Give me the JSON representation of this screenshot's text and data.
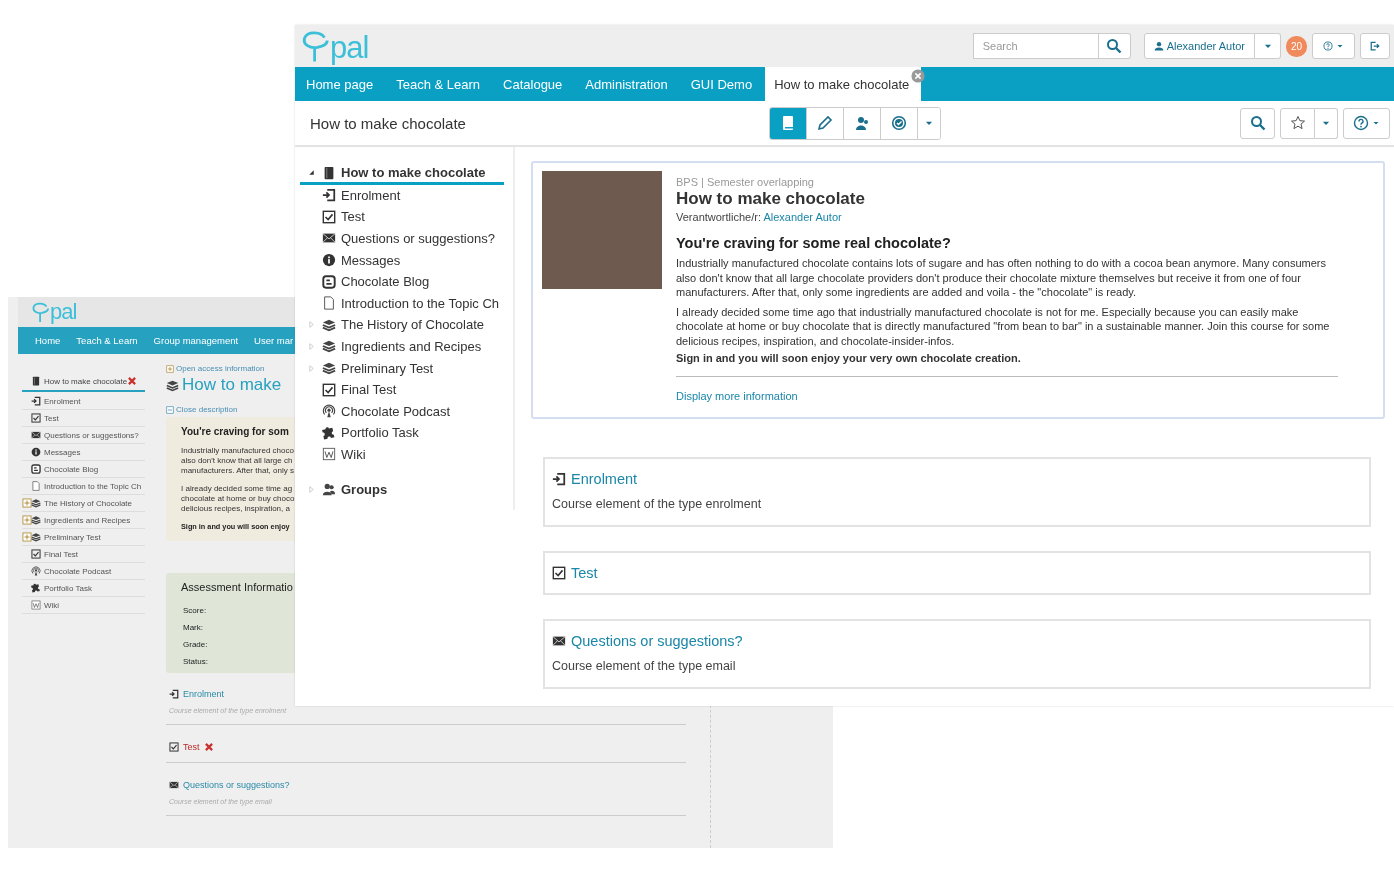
{
  "back_window": {
    "logo": "pal",
    "nav": [
      {
        "label": "Home"
      },
      {
        "label": "Teach & Learn"
      },
      {
        "label": "Group management"
      },
      {
        "label": "User mar"
      }
    ],
    "tree": [
      {
        "label": "How to make chocolate",
        "kind": "course",
        "selected": true,
        "failed": true,
        "children": [
          {
            "label": "Enrolment",
            "kind": "enrolment",
            "selected": false,
            "failed": false
          },
          {
            "label": "Test",
            "kind": "test",
            "selected": false,
            "failed": false
          },
          {
            "label": "Questions or suggestions?",
            "kind": "mail",
            "selected": false,
            "failed": false
          },
          {
            "label": "Messages",
            "kind": "info",
            "selected": false,
            "failed": false
          },
          {
            "label": "Chocolate Blog",
            "kind": "blog",
            "selected": false,
            "failed": false
          },
          {
            "label": "Introduction to the Topic Ch",
            "kind": "page",
            "selected": false,
            "failed": false
          },
          {
            "label": "The History of Chocolate",
            "kind": "structure",
            "selected": false,
            "failed": false,
            "expanded": false
          },
          {
            "label": "Ingredients and Recipes",
            "kind": "structure",
            "selected": false,
            "failed": false,
            "expanded": false
          },
          {
            "label": "Preliminary Test",
            "kind": "structure",
            "selected": false,
            "failed": false,
            "expanded": false
          },
          {
            "label": "Final Test",
            "kind": "test",
            "selected": false,
            "failed": false
          },
          {
            "label": "Chocolate Podcast",
            "kind": "podcast",
            "selected": false,
            "failed": false
          },
          {
            "label": "Portfolio Task",
            "kind": "portfolio",
            "selected": false,
            "failed": false
          },
          {
            "label": "Wiki",
            "kind": "wiki",
            "selected": false,
            "failed": false
          }
        ]
      }
    ],
    "content": {
      "access_link": "Open access information",
      "title": "How to make",
      "close_link": "Close description",
      "heading": "You're craving for som",
      "paragraphs": [
        [
          "Industrially manufactured choco",
          "also don't know that all large ch",
          "manufacturers. After that, only s"
        ],
        [
          "I already decided some time ag",
          "chocolate at home or buy choco",
          "delicious recipes, inspiration, a"
        ]
      ],
      "closing": "Sign in and you will soon enjoy",
      "assessment": {
        "title": "Assessment Informatio",
        "fields": [
          "Score:",
          "Mark:",
          "Grade:",
          "Status:"
        ]
      },
      "elements": [
        {
          "label": "Enrolment",
          "kind": "enrolment",
          "failed": false,
          "description": "Course element of the type enrolment"
        },
        {
          "label": "Test",
          "kind": "test",
          "failed": true
        },
        {
          "label": "Questions or suggestions?",
          "kind": "mail",
          "failed": false,
          "description": "Course element of the type email"
        }
      ]
    }
  },
  "front_window": {
    "logo": "pal",
    "search": {
      "placeholder": "Search"
    },
    "user": "Alexander Autor",
    "badge": "20",
    "nav": [
      {
        "label": "Home page",
        "selected": false
      },
      {
        "label": "Teach & Learn",
        "selected": false
      },
      {
        "label": "Catalogue",
        "selected": false
      },
      {
        "label": "Administration",
        "selected": false
      },
      {
        "label": "GUI Demo",
        "selected": false
      },
      {
        "label": "How to make chocolate",
        "selected": true,
        "closable": true
      }
    ],
    "toolbar": {
      "title": "How to make chocolate",
      "modes": [
        {
          "kind": "book",
          "selected": true
        },
        {
          "kind": "pencil",
          "selected": false
        },
        {
          "kind": "users",
          "selected": false
        },
        {
          "kind": "check",
          "selected": false
        }
      ]
    },
    "tree": [
      {
        "label": "How to make chocolate",
        "kind": "course",
        "selected": true,
        "expanded": true,
        "children": [
          {
            "label": "Enrolment",
            "kind": "enrolment",
            "selected": false
          },
          {
            "label": "Test",
            "kind": "test",
            "selected": false
          },
          {
            "label": "Questions or suggestions?",
            "kind": "mail",
            "selected": false
          },
          {
            "label": "Messages",
            "kind": "info",
            "selected": false
          },
          {
            "label": "Chocolate Blog",
            "kind": "blog",
            "selected": false
          },
          {
            "label": "Introduction to the Topic Ch",
            "kind": "page",
            "selected": false
          },
          {
            "label": "The History of Chocolate",
            "kind": "structure",
            "selected": false,
            "expanded": false
          },
          {
            "label": "Ingredients and Recipes",
            "kind": "structure",
            "selected": false,
            "expanded": false
          },
          {
            "label": "Preliminary Test",
            "kind": "structure",
            "selected": false,
            "expanded": false
          },
          {
            "label": "Final Test",
            "kind": "test",
            "selected": false
          },
          {
            "label": "Chocolate Podcast",
            "kind": "podcast",
            "selected": false
          },
          {
            "label": "Portfolio Task",
            "kind": "portfolio",
            "selected": false
          },
          {
            "label": "Wiki",
            "kind": "wiki",
            "selected": false
          }
        ]
      },
      {
        "label": "Groups",
        "kind": "group",
        "selected": false,
        "expanded": false
      }
    ],
    "course": {
      "meta": "BPS | Semester overlapping",
      "title": "How to make chocolate",
      "owner_label": "Verantwortliche/r:",
      "owner": "Alexander Autor",
      "heading": "You're craving for some real chocolate?",
      "paragraphs": [
        "Industrially manufactured chocolate contains lots of sugare and has often nothing to do with a cocoa bean anymore. Many consumers also don't know that all large chocolate providers don't produce their chocolate mixture themselves but receive it from one of four manufacturers. After that, only some ingredients are added and voila - the \"chocolate\" is ready.",
        "I already decided some time ago that industrially manufactured chocolate is not for me. Especially because you can easily make chocolate at home or buy chocolate that is directly manufactured \"from bean to bar\" in a sustainable manner. Join this course for some delicious recipes, inspiration, and chocolate-insider-infos."
      ],
      "closing": "Sign in and you will soon enjoy your very own chocolate creation.",
      "more_link": "Display more information"
    },
    "elements": [
      {
        "label": "Enrolment",
        "kind": "enrolment",
        "description": "Course element of the type enrolment"
      },
      {
        "label": "Test",
        "kind": "test"
      },
      {
        "label": "Questions or suggestions?",
        "kind": "mail",
        "description": "Course element of the type email"
      }
    ]
  }
}
